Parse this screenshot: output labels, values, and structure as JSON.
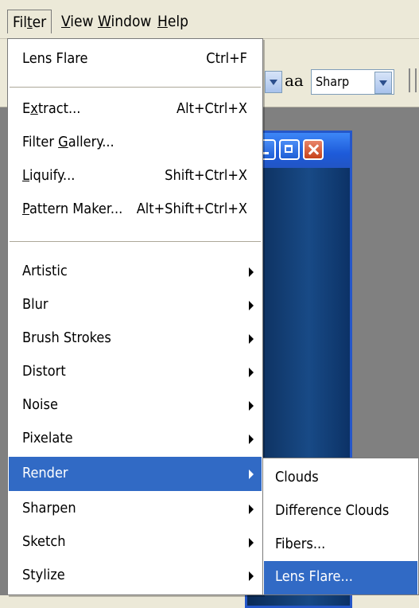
{
  "menubar": {
    "items": [
      {
        "pre": "Fil",
        "u": "t",
        "post": "er"
      },
      {
        "pre": "",
        "u": "V",
        "post": "iew"
      },
      {
        "pre": "",
        "u": "W",
        "post": "indow"
      },
      {
        "pre": "",
        "u": "H",
        "post": "elp"
      }
    ]
  },
  "options_bar": {
    "antialias_icon": "aa",
    "antialias_value": "Sharp"
  },
  "filter_menu": {
    "last_filter": {
      "label": "Lens Flare",
      "shortcut": "Ctrl+F"
    },
    "group2": [
      {
        "pre": "E",
        "u": "x",
        "post": "tract...",
        "shortcut": "Alt+Ctrl+X"
      },
      {
        "pre": "Filter ",
        "u": "G",
        "post": "allery...",
        "shortcut": ""
      },
      {
        "pre": "",
        "u": "L",
        "post": "iquify...",
        "shortcut": "Shift+Ctrl+X"
      },
      {
        "pre": "",
        "u": "P",
        "post": "attern Maker...",
        "shortcut": "Alt+Shift+Ctrl+X"
      }
    ],
    "submenus": [
      {
        "label": "Artistic"
      },
      {
        "label": "Blur"
      },
      {
        "label": "Brush Strokes"
      },
      {
        "label": "Distort"
      },
      {
        "label": "Noise"
      },
      {
        "label": "Pixelate"
      },
      {
        "label": "Render",
        "selected": true
      },
      {
        "label": "Sharpen"
      },
      {
        "label": "Sketch"
      },
      {
        "label": "Stylize"
      }
    ],
    "selected_color": "#316ac5"
  },
  "render_submenu": {
    "items": [
      {
        "label": "Clouds"
      },
      {
        "label": "Difference Clouds"
      },
      {
        "label": "Fibers..."
      },
      {
        "label": "Lens Flare...",
        "selected": true
      }
    ]
  }
}
